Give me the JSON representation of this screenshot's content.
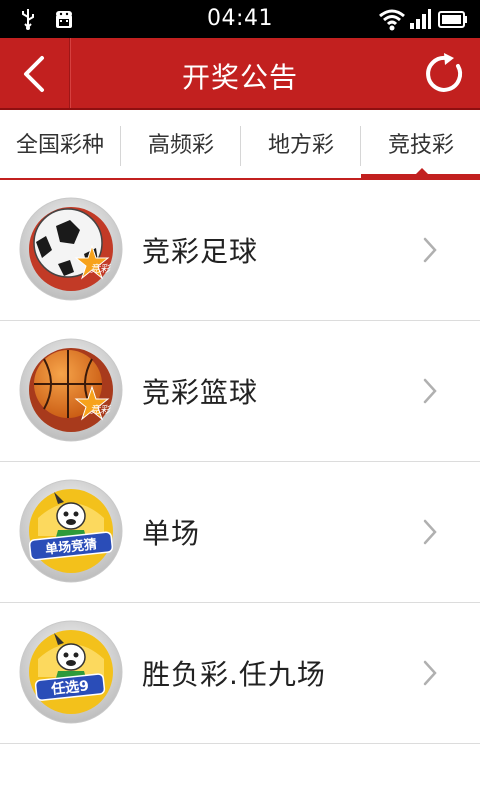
{
  "status_bar": {
    "time": "04:41",
    "icons": [
      "usb-icon",
      "android-debug-icon",
      "wifi-icon",
      "signal-icon",
      "battery-icon"
    ]
  },
  "header": {
    "title": "开奖公告",
    "back_icon": "chevron-left-icon",
    "refresh_icon": "refresh-icon",
    "color": "#c2201f"
  },
  "tabs": [
    {
      "label": "全国彩种",
      "active": false
    },
    {
      "label": "高频彩",
      "active": false
    },
    {
      "label": "地方彩",
      "active": false
    },
    {
      "label": "竞技彩",
      "active": true
    }
  ],
  "list": [
    {
      "label": "竞彩足球",
      "icon": "football-icon",
      "badge": "竞彩"
    },
    {
      "label": "竞彩篮球",
      "icon": "basketball-icon",
      "badge": "竞彩"
    },
    {
      "label": "单场",
      "icon": "single-match-icon",
      "badge": "单场竞猜"
    },
    {
      "label": "胜负彩.任九场",
      "icon": "pick-nine-icon",
      "badge": "任选9"
    }
  ]
}
